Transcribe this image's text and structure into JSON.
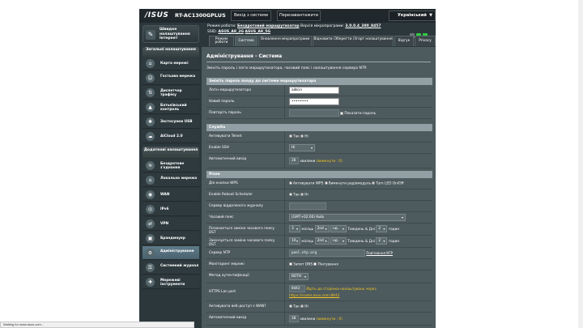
{
  "header": {
    "logo": "/ISUS",
    "model": "RT-AC1300GPLUS",
    "logout_label": "Вихід з системи",
    "reboot_label": "Перезавантажити",
    "language": "Український",
    "mode_label": "Режим роботи:",
    "mode_value": "Бездротовий маршрутизатор",
    "firmware_label": "Версія мікропрограми:",
    "firmware_value": "3.0.0.4_380_8457",
    "ssid_label": "SSID:",
    "ssid_1": "ASUS_A8_2G",
    "ssid_2": "ASUS_A8_5G"
  },
  "sidebar": {
    "qis": "Швидке налаштування Інтернет",
    "general_head": "Загальні налаштування",
    "general_items": [
      {
        "label": "Карта мережі",
        "icon": "map-icon"
      },
      {
        "label": "Гостьова мережа",
        "icon": "guest-icon"
      },
      {
        "label": "Диспетчер трафіку",
        "icon": "traffic-icon"
      },
      {
        "label": "Батьківський контроль",
        "icon": "lock-icon"
      },
      {
        "label": "Застосунки USB",
        "icon": "usb-icon"
      },
      {
        "label": "AiCloud 2.0",
        "icon": "cloud-icon"
      }
    ],
    "advanced_head": "Додаткові налаштування",
    "advanced_items": [
      {
        "label": "Бездротове з'єднання",
        "icon": "wifi-icon"
      },
      {
        "label": "Локальна мережа",
        "icon": "home-icon"
      },
      {
        "label": "WAN",
        "icon": "globe-icon"
      },
      {
        "label": "IPv6",
        "icon": "ipv6-icon"
      },
      {
        "label": "VPN",
        "icon": "vpn-icon"
      },
      {
        "label": "Брандмауер",
        "icon": "firewall-icon"
      },
      {
        "label": "Адміністрування",
        "icon": "admin-icon"
      },
      {
        "label": "Системний журнал",
        "icon": "log-icon"
      },
      {
        "label": "Мережеві інструменти",
        "icon": "tools-icon"
      }
    ]
  },
  "tabs": [
    "Режим роботи",
    "Система",
    "Оновлення мікропрограми",
    "Відновити /Зберегти /Згорт налаштування",
    "Відгук",
    "Privacy"
  ],
  "panel": {
    "title": "Адміністрування - Система",
    "desc": "Змініть пароль і логін маршрутизатора, часовий пояс і налаштування сервера NTP.",
    "sec_password": "Змініть пароль входу до системи маршрутизатора",
    "login_label": "Логін маршрутизатора",
    "login_value": "admin",
    "newpass_label": "Новий пароль",
    "newpass_value": "••••••••",
    "repeat_label": "Повторіть пароль",
    "show_pass": "Показати пароль",
    "sec_service": "Служба",
    "telnet_label": "Активувати Telnet",
    "yes": "Так",
    "no": "Ні",
    "ssh_label": "Enable SSH",
    "ssh_value": "Ні",
    "logout_label": "Автоматичний вихід",
    "logout_value": "20",
    "minutes_hint": "хвилини",
    "logout_note": "(вимкнути : 0)",
    "sec_misc": "Різне",
    "wps_label": "Дія кнопки WPS",
    "wps_1": "Активувати WPS",
    "wps_2": "Вимкнути радіомодуль",
    "wps_3": "Turn LED On/Off",
    "reboot_sched_label": "Enable Reboot Scheduler",
    "syslog_label": "Сервер віддаленого журналу",
    "tz_label": "Часовий пояс",
    "tz_value": "(GMT+02:00) Київ",
    "dst_start_label": "Починається заміна часового поясу DST",
    "dst_end_label": "Закінчується заміна часового поясу DST",
    "dst_start": {
      "month": "3",
      "week": "2nd",
      "day": "нд.",
      "mid": "Тиждень & Дні",
      "hour": "2",
      "unit": "годин"
    },
    "dst_end": {
      "month": "10",
      "week": "2nd",
      "day": "нд.",
      "mid": "Тиждень & Дні",
      "hour": "2",
      "unit": "годин"
    },
    "ntp_label": "Сервер NTP",
    "ntp_value": "pool.ntp.org",
    "ntp_link": "Пов'язання NTP",
    "netmon_label": "Моніторинг мережі",
    "dns_query": "Запит DNS",
    "ping": "Пінгування",
    "auth_label": "Метод аутентифікації",
    "auth_value": "BOTH",
    "https_label": "HTTPS Lan port",
    "https_value": "8443",
    "https_note": "Йдіть до сторінки налаштувань через",
    "https_url": "https://router.asus.com:8443",
    "webaccess_label": "Активувати веб-доступ з WAN?",
    "logout2_label": "Автоматичний вихід",
    "logout2_value": "30"
  },
  "statusbar": "Waiting for www.asus.com..."
}
